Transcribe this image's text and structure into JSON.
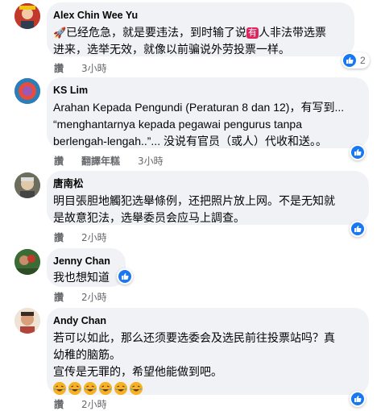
{
  "comments": [
    {
      "name": "Alex Chin Wee Yu",
      "line1_prefix": "已经危急，就是要违法，到时输了说",
      "badge": "有",
      "line1_suffix": "人非法带选票",
      "line2": "进来，选举无效，就像以前骗说外劳投票一样。",
      "action": "讚",
      "time": "3小時",
      "reactions": "2"
    },
    {
      "name": "KS Lim",
      "line1": "Arahan Kepada Pengundi (Peraturan 8 dan 12)，有写到...",
      "line2": "“menghantarnya kepada pegawai pengurus tanpa",
      "line3": "berlengah-lengah..”... 没说有官员（或人）代收和送。。",
      "action": "讚",
      "translate": "翻譯年糕",
      "time": "3小時"
    },
    {
      "name": "唐南松",
      "line1": "明目張胆地觸犯选舉條例，还把照片放上网。不是无知就",
      "line2": "是故意犯法，选舉委员会应马上調查。",
      "action": "讚",
      "time": "2小時"
    },
    {
      "name": "Jenny Chan",
      "line1": "我也想知道",
      "action": "讚",
      "time": "2小時"
    },
    {
      "name": "Andy Chan",
      "line1": "若可以如此，那么还须要选委会及选民前往投票站吗？真",
      "line2": "幼稚的脑筋。",
      "line3": "宣传是无罪的，希望他能做到吧。",
      "action": "讚",
      "time": "2小時"
    }
  ],
  "colors": {
    "bubble": "#f0f2f5",
    "like_blue": "#1877f2",
    "meta_gray": "#65676b"
  },
  "icons": {
    "reaction": "like-thumb-icon",
    "rocket": "rocket-emoji-icon",
    "laugh": "laughing-emoji-icon"
  }
}
